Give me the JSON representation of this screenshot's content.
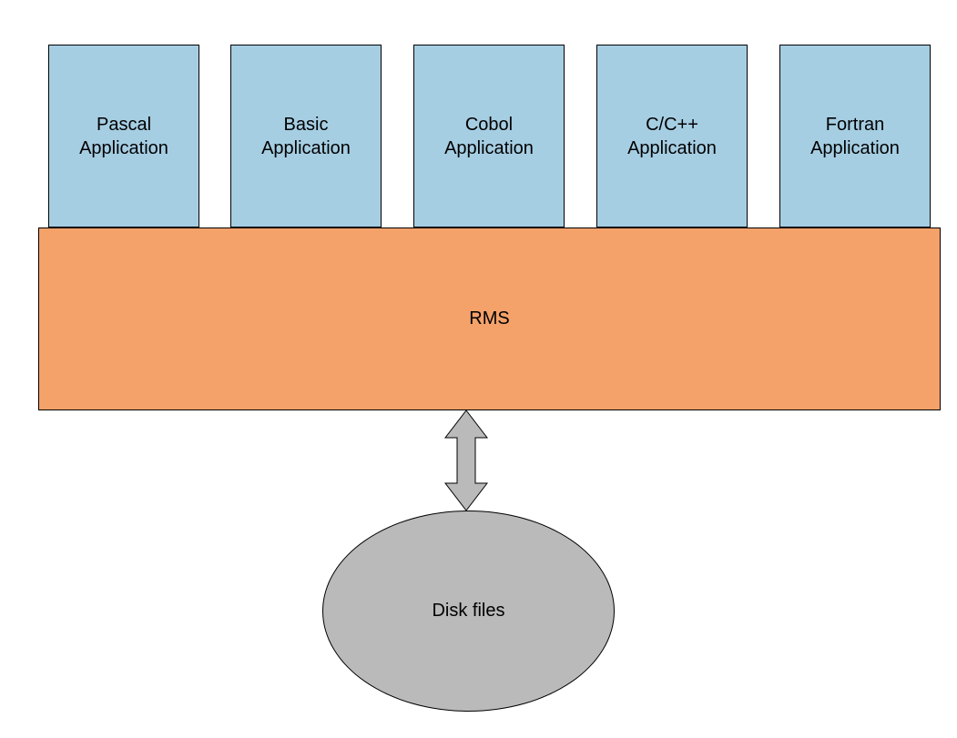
{
  "apps": [
    {
      "line1": "Pascal",
      "line2": "Application"
    },
    {
      "line1": "Basic",
      "line2": "Application"
    },
    {
      "line1": "Cobol",
      "line2": "Application"
    },
    {
      "line1": "C/C++",
      "line2": "Application"
    },
    {
      "line1": "Fortran",
      "line2": "Application"
    }
  ],
  "middleware": {
    "label": "RMS"
  },
  "storage": {
    "label": "Disk files"
  }
}
